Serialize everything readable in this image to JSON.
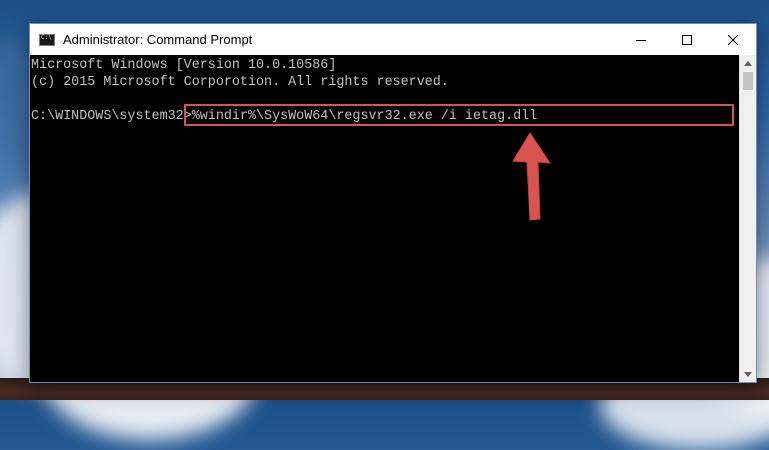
{
  "window": {
    "title": "Administrator: Command Prompt",
    "buttons": {
      "minimize": "minimize-icon",
      "maximize": "maximize-icon",
      "close": "close-icon"
    }
  },
  "console": {
    "lines": [
      "Microsoft Windows [Version 10.0.10586]",
      "(c) 2015 Microsoft Corporotion. All rights reserved."
    ],
    "prompt": "C:\\WINDOWS\\system32>",
    "command": "%windir%\\SysWoW64\\regsvr32.exe /i ietag.dll"
  },
  "colors": {
    "console_bg": "#000000",
    "console_text": "#c0c0c0",
    "highlight": "#d9534f",
    "arrow": "#d9534f"
  },
  "icons": [
    "cmd-app-icon",
    "minimize-icon",
    "maximize-icon",
    "close-icon",
    "scroll-up-icon",
    "scroll-down-icon",
    "red-arrow-icon"
  ]
}
